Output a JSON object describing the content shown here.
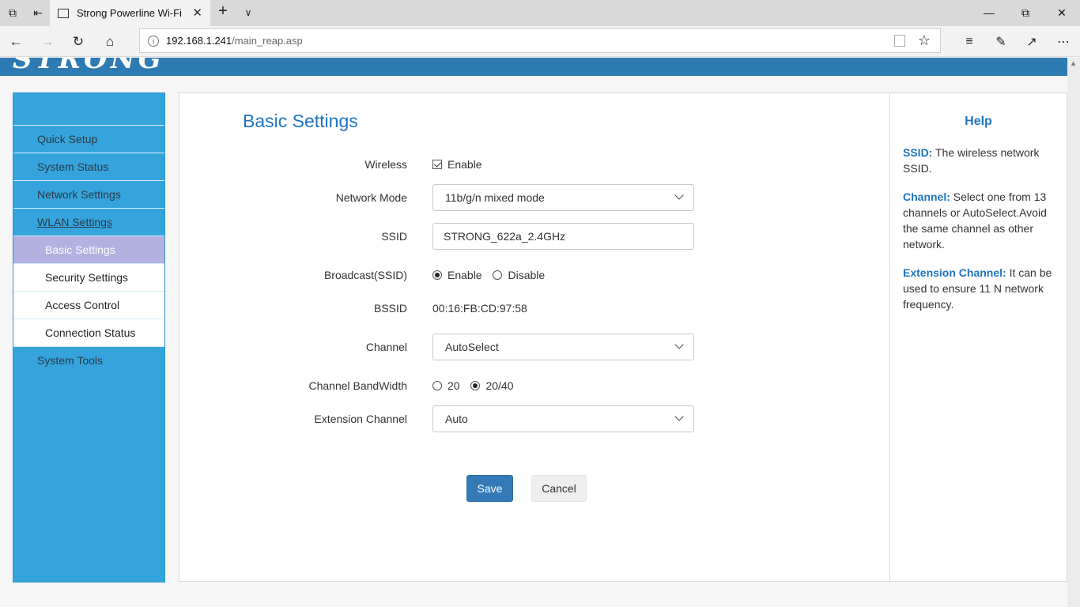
{
  "browser": {
    "tab_title": "Strong Powerline Wi-Fi",
    "url_host": "192.168.1.241",
    "url_path": "/main_reap.asp"
  },
  "brand": {
    "logo_text": "STRONG",
    "header_color": "#2e7ab2"
  },
  "sidebar": {
    "items": [
      {
        "label": "Quick Setup"
      },
      {
        "label": "System Status"
      },
      {
        "label": "Network Settings"
      },
      {
        "label": "WLAN Settings"
      },
      {
        "label": "Basic Settings"
      },
      {
        "label": "Security Settings"
      },
      {
        "label": "Access Control"
      },
      {
        "label": "Connection Status"
      },
      {
        "label": "System Tools"
      }
    ],
    "active": "Basic Settings"
  },
  "form": {
    "title": "Basic Settings",
    "wireless": {
      "label": "Wireless",
      "option": "Enable",
      "checked": true
    },
    "network_mode": {
      "label": "Network Mode",
      "value": "11b/g/n mixed mode"
    },
    "ssid": {
      "label": "SSID",
      "value": "STRONG_622a_2.4GHz"
    },
    "broadcast": {
      "label": "Broadcast(SSID)",
      "options": [
        "Enable",
        "Disable"
      ],
      "selected": "Enable"
    },
    "bssid": {
      "label": "BSSID",
      "value": "00:16:FB:CD:97:58"
    },
    "channel": {
      "label": "Channel",
      "value": "AutoSelect"
    },
    "bandwidth": {
      "label": "Channel BandWidth",
      "options": [
        "20",
        "20/40"
      ],
      "selected": "20/40"
    },
    "extension": {
      "label": "Extension Channel",
      "value": "Auto"
    },
    "save_label": "Save",
    "cancel_label": "Cancel"
  },
  "help": {
    "title": "Help",
    "entries": [
      {
        "term": "SSID:",
        "text": " The wireless network SSID."
      },
      {
        "term": "Channel:",
        "text": " Select one from 13 channels or AutoSelect.Avoid the same channel as other network."
      },
      {
        "term": "Extension Channel:",
        "text": " It can be used to ensure 11 N network frequency."
      }
    ]
  }
}
